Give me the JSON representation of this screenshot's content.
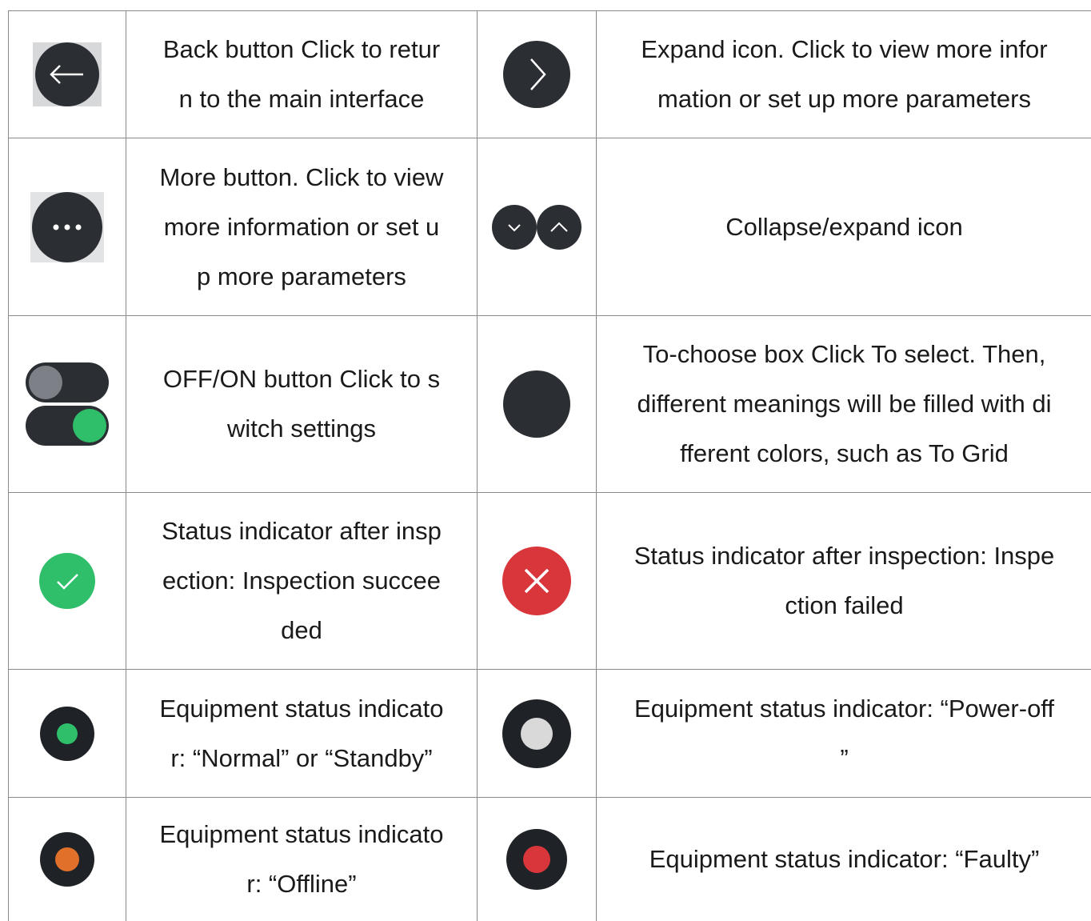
{
  "rows": [
    {
      "left": {
        "icon": "back-arrow-icon",
        "lines": [
          "Back button Click to retur",
          "n to the main interface"
        ]
      },
      "right": {
        "icon": "expand-chevron-icon",
        "lines": [
          "Expand icon. Click to view more infor",
          "mation or set up more parameters"
        ]
      }
    },
    {
      "left": {
        "icon": "more-dots-icon",
        "lines": [
          "More button. Click to view",
          "more information or set u",
          "p more parameters"
        ]
      },
      "right": {
        "icon": "collapse-expand-icon",
        "lines": [
          "Collapse/expand icon"
        ]
      }
    },
    {
      "left": {
        "icon": "toggle-switch-icon",
        "lines": [
          "OFF/ON button Click to s",
          "witch settings"
        ]
      },
      "right": {
        "icon": "choose-box-icon",
        "lines": [
          "To-choose box Click To select. Then,",
          "different meanings will be filled with di",
          "fferent colors, such as To Grid"
        ]
      }
    },
    {
      "left": {
        "icon": "check-success-icon",
        "lines": [
          "Status indicator after insp",
          "ection: Inspection succee",
          "ded"
        ]
      },
      "right": {
        "icon": "cross-failed-icon",
        "lines": [
          "Status indicator after inspection: Inspe",
          "ction failed"
        ]
      }
    },
    {
      "left": {
        "icon": "status-normal-icon",
        "lines": [
          "Equipment status indicato",
          "r: “Normal” or “Standby”"
        ]
      },
      "right": {
        "icon": "status-power-off-icon",
        "lines": [
          "Equipment status indicator: “Power-off",
          "”"
        ]
      }
    },
    {
      "left": {
        "icon": "status-offline-icon",
        "lines": [
          "Equipment status indicato",
          "r: “Offline”"
        ]
      },
      "right": {
        "icon": "status-faulty-icon",
        "lines": [
          "Equipment status indicator: “Faulty”"
        ]
      }
    }
  ],
  "colors": {
    "icon_dark": "#2b2e33",
    "green": "#2fbf6a",
    "red": "#d8363b",
    "orange": "#e0702a",
    "grey_light": "#d9d9d9",
    "border": "#8a8a8a"
  }
}
